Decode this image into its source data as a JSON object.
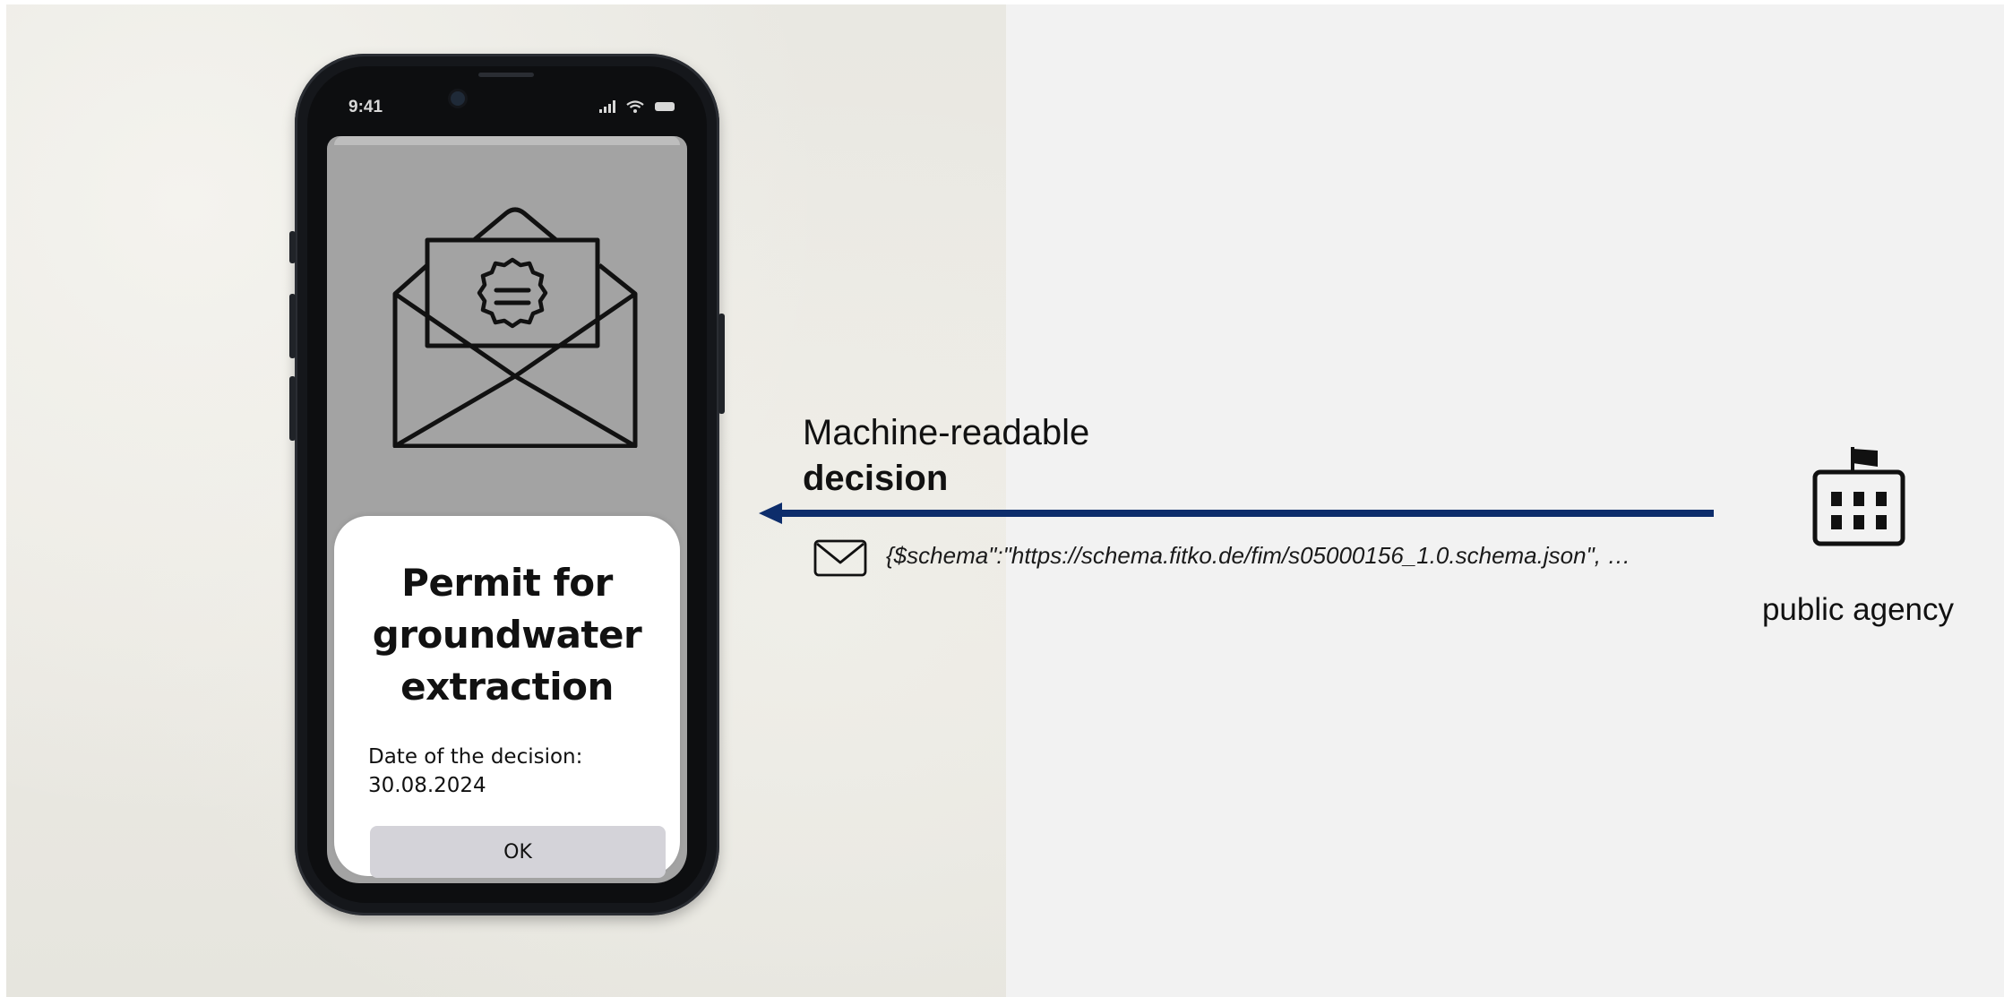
{
  "phone": {
    "status_time": "9:41",
    "card": {
      "title": "Permit for\ngroundwater\nextraction",
      "date_label": "Date of the decision:",
      "date_value": "30.08.2024",
      "ok_label": "OK"
    }
  },
  "flow": {
    "label_line1": "Machine-readable",
    "label_line2": "decision",
    "json_snippet": "{$schema\":\"https://schema.fitko.de/fim/s05000156_1.0.schema.json\", …",
    "arrow_color": "#0d2d6b"
  },
  "agency": {
    "label": "public agency"
  },
  "icons": [
    "open-envelope-icon",
    "envelope-icon",
    "government-building-icon",
    "signal-icon",
    "wifi-icon",
    "battery-icon"
  ]
}
